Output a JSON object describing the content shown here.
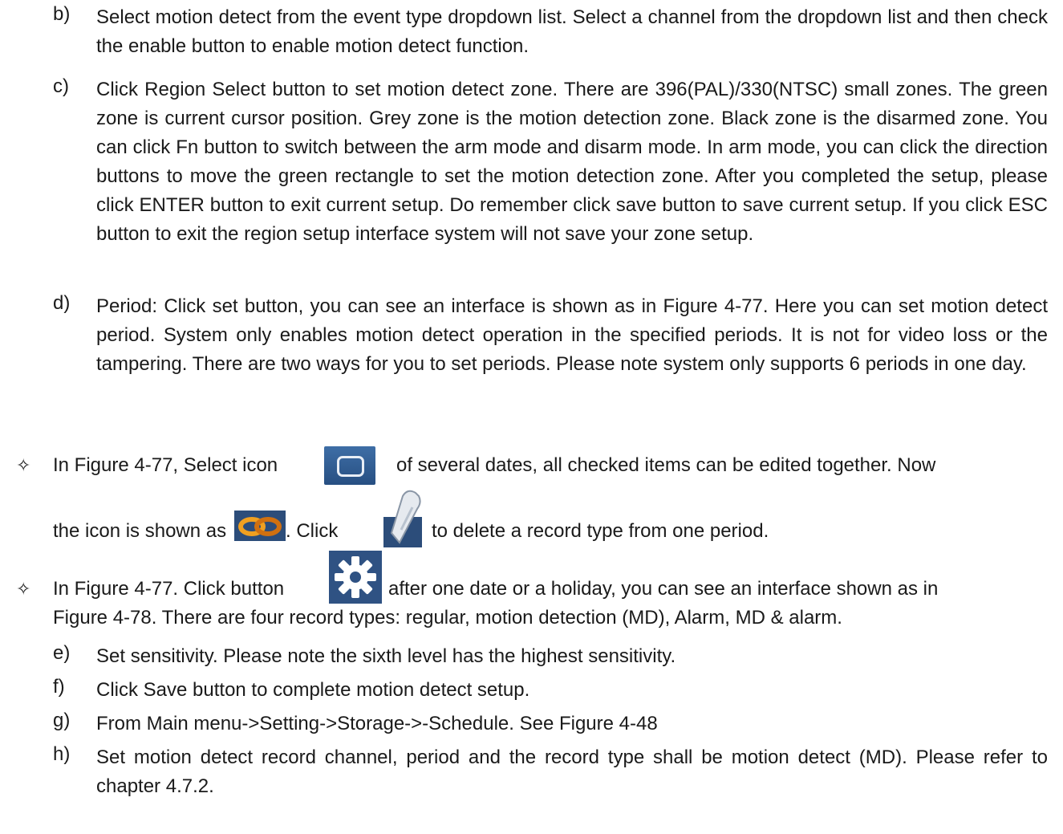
{
  "steps": [
    {
      "label": "b)",
      "text": "Select motion detect from the event type dropdown list. Select a channel from the dropdown list and then check the enable button to enable motion detect function."
    },
    {
      "label": "c)",
      "text": "Click Region Select button to set motion detect zone. There are 396(PAL)/330(NTSC) small zones. The green zone is current cursor position. Grey zone is the motion detection zone. Black zone is the disarmed zone. You can click Fn button to switch between the arm mode and disarm mode.  In arm mode, you can click the direction buttons to move the green rectangle to set the motion detection zone. After you completed the setup, please click ENTER button to exit current setup. Do remember click save button to save current setup. If you click ESC button to exit the region setup interface system will not save your zone setup."
    },
    {
      "label": "d)",
      "text": "Period: Click set button, you can see an interface is shown as in Figure 4-77. Here you can set motion detect period. System only enables motion detect operation in the specified periods. It is not for video loss or the tampering. There are two ways for you to set periods. Please note system only supports 6 periods in one day."
    }
  ],
  "bullet1": {
    "symbol": "✧",
    "part1": "In Figure 4-77, Select icon",
    "part2": "of several dates, all checked items can be edited together. Now",
    "part3": "the icon is shown as",
    "part4": ". Click",
    "part5": "to delete a record type from one period.",
    "icons": [
      "select-square-icon",
      "link-icon",
      "eraser-icon"
    ]
  },
  "bullet2": {
    "symbol": "✧",
    "part1": "In Figure 4-77. Click button",
    "part2": "after one date or a holiday, you can see an interface shown as in",
    "line2": "Figure 4-78. There are four record types: regular, motion detection (MD), Alarm, MD & alarm.",
    "icons": [
      "gear-icon"
    ]
  },
  "steps2": [
    {
      "label": "e)",
      "text": "Set sensitivity. Please note the sixth level has the highest sensitivity."
    },
    {
      "label": "f)",
      "text": "Click Save button to complete motion detect setup."
    },
    {
      "label": "g)",
      "text": "From Main menu->Setting->Storage->-Schedule. See Figure 4-48"
    },
    {
      "label": "h)",
      "text": "Set motion detect record channel, period and the record type shall be motion detect (MD). Please refer to chapter 4.7.2."
    }
  ]
}
